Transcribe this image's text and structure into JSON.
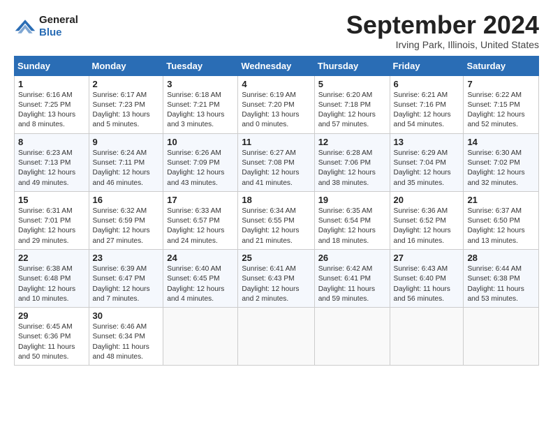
{
  "header": {
    "logo_line1": "General",
    "logo_line2": "Blue",
    "month": "September 2024",
    "location": "Irving Park, Illinois, United States"
  },
  "columns": [
    "Sunday",
    "Monday",
    "Tuesday",
    "Wednesday",
    "Thursday",
    "Friday",
    "Saturday"
  ],
  "weeks": [
    [
      {
        "day": "1",
        "info": "Sunrise: 6:16 AM\nSunset: 7:25 PM\nDaylight: 13 hours\nand 8 minutes."
      },
      {
        "day": "2",
        "info": "Sunrise: 6:17 AM\nSunset: 7:23 PM\nDaylight: 13 hours\nand 5 minutes."
      },
      {
        "day": "3",
        "info": "Sunrise: 6:18 AM\nSunset: 7:21 PM\nDaylight: 13 hours\nand 3 minutes."
      },
      {
        "day": "4",
        "info": "Sunrise: 6:19 AM\nSunset: 7:20 PM\nDaylight: 13 hours\nand 0 minutes."
      },
      {
        "day": "5",
        "info": "Sunrise: 6:20 AM\nSunset: 7:18 PM\nDaylight: 12 hours\nand 57 minutes."
      },
      {
        "day": "6",
        "info": "Sunrise: 6:21 AM\nSunset: 7:16 PM\nDaylight: 12 hours\nand 54 minutes."
      },
      {
        "day": "7",
        "info": "Sunrise: 6:22 AM\nSunset: 7:15 PM\nDaylight: 12 hours\nand 52 minutes."
      }
    ],
    [
      {
        "day": "8",
        "info": "Sunrise: 6:23 AM\nSunset: 7:13 PM\nDaylight: 12 hours\nand 49 minutes."
      },
      {
        "day": "9",
        "info": "Sunrise: 6:24 AM\nSunset: 7:11 PM\nDaylight: 12 hours\nand 46 minutes."
      },
      {
        "day": "10",
        "info": "Sunrise: 6:26 AM\nSunset: 7:09 PM\nDaylight: 12 hours\nand 43 minutes."
      },
      {
        "day": "11",
        "info": "Sunrise: 6:27 AM\nSunset: 7:08 PM\nDaylight: 12 hours\nand 41 minutes."
      },
      {
        "day": "12",
        "info": "Sunrise: 6:28 AM\nSunset: 7:06 PM\nDaylight: 12 hours\nand 38 minutes."
      },
      {
        "day": "13",
        "info": "Sunrise: 6:29 AM\nSunset: 7:04 PM\nDaylight: 12 hours\nand 35 minutes."
      },
      {
        "day": "14",
        "info": "Sunrise: 6:30 AM\nSunset: 7:02 PM\nDaylight: 12 hours\nand 32 minutes."
      }
    ],
    [
      {
        "day": "15",
        "info": "Sunrise: 6:31 AM\nSunset: 7:01 PM\nDaylight: 12 hours\nand 29 minutes."
      },
      {
        "day": "16",
        "info": "Sunrise: 6:32 AM\nSunset: 6:59 PM\nDaylight: 12 hours\nand 27 minutes."
      },
      {
        "day": "17",
        "info": "Sunrise: 6:33 AM\nSunset: 6:57 PM\nDaylight: 12 hours\nand 24 minutes."
      },
      {
        "day": "18",
        "info": "Sunrise: 6:34 AM\nSunset: 6:55 PM\nDaylight: 12 hours\nand 21 minutes."
      },
      {
        "day": "19",
        "info": "Sunrise: 6:35 AM\nSunset: 6:54 PM\nDaylight: 12 hours\nand 18 minutes."
      },
      {
        "day": "20",
        "info": "Sunrise: 6:36 AM\nSunset: 6:52 PM\nDaylight: 12 hours\nand 16 minutes."
      },
      {
        "day": "21",
        "info": "Sunrise: 6:37 AM\nSunset: 6:50 PM\nDaylight: 12 hours\nand 13 minutes."
      }
    ],
    [
      {
        "day": "22",
        "info": "Sunrise: 6:38 AM\nSunset: 6:48 PM\nDaylight: 12 hours\nand 10 minutes."
      },
      {
        "day": "23",
        "info": "Sunrise: 6:39 AM\nSunset: 6:47 PM\nDaylight: 12 hours\nand 7 minutes."
      },
      {
        "day": "24",
        "info": "Sunrise: 6:40 AM\nSunset: 6:45 PM\nDaylight: 12 hours\nand 4 minutes."
      },
      {
        "day": "25",
        "info": "Sunrise: 6:41 AM\nSunset: 6:43 PM\nDaylight: 12 hours\nand 2 minutes."
      },
      {
        "day": "26",
        "info": "Sunrise: 6:42 AM\nSunset: 6:41 PM\nDaylight: 11 hours\nand 59 minutes."
      },
      {
        "day": "27",
        "info": "Sunrise: 6:43 AM\nSunset: 6:40 PM\nDaylight: 11 hours\nand 56 minutes."
      },
      {
        "day": "28",
        "info": "Sunrise: 6:44 AM\nSunset: 6:38 PM\nDaylight: 11 hours\nand 53 minutes."
      }
    ],
    [
      {
        "day": "29",
        "info": "Sunrise: 6:45 AM\nSunset: 6:36 PM\nDaylight: 11 hours\nand 50 minutes."
      },
      {
        "day": "30",
        "info": "Sunrise: 6:46 AM\nSunset: 6:34 PM\nDaylight: 11 hours\nand 48 minutes."
      },
      {
        "day": "",
        "info": ""
      },
      {
        "day": "",
        "info": ""
      },
      {
        "day": "",
        "info": ""
      },
      {
        "day": "",
        "info": ""
      },
      {
        "day": "",
        "info": ""
      }
    ]
  ]
}
